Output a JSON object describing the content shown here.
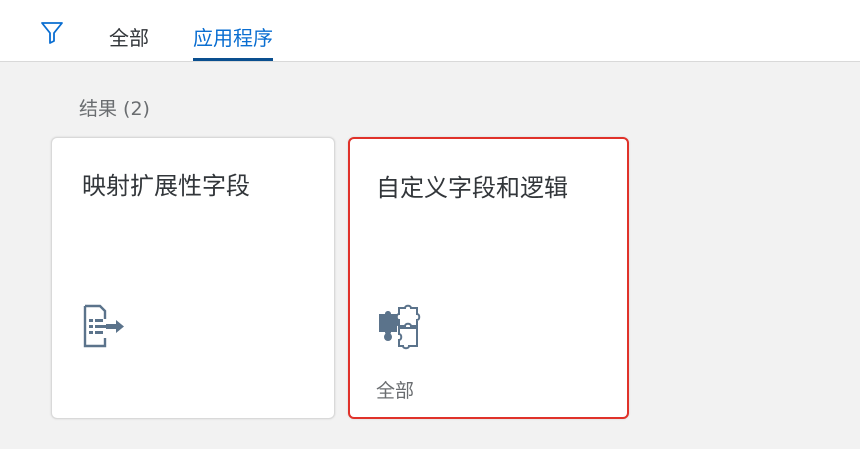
{
  "header": {
    "filter_icon": "filter-icon",
    "tabs": [
      {
        "label": "全部",
        "selected": false
      },
      {
        "label": "应用程序",
        "selected": true
      }
    ]
  },
  "results": {
    "label": "结果 (2)"
  },
  "cards": [
    {
      "title": "映射扩展性字段",
      "icon": "field-mapping-icon",
      "subtitle": ""
    },
    {
      "title": "自定义字段和逻辑",
      "icon": "puzzle-icon",
      "subtitle": "全部"
    }
  ],
  "colors": {
    "accent": "#0a6ed1",
    "icon": "#5b738b",
    "selection_border": "#e0322a"
  }
}
